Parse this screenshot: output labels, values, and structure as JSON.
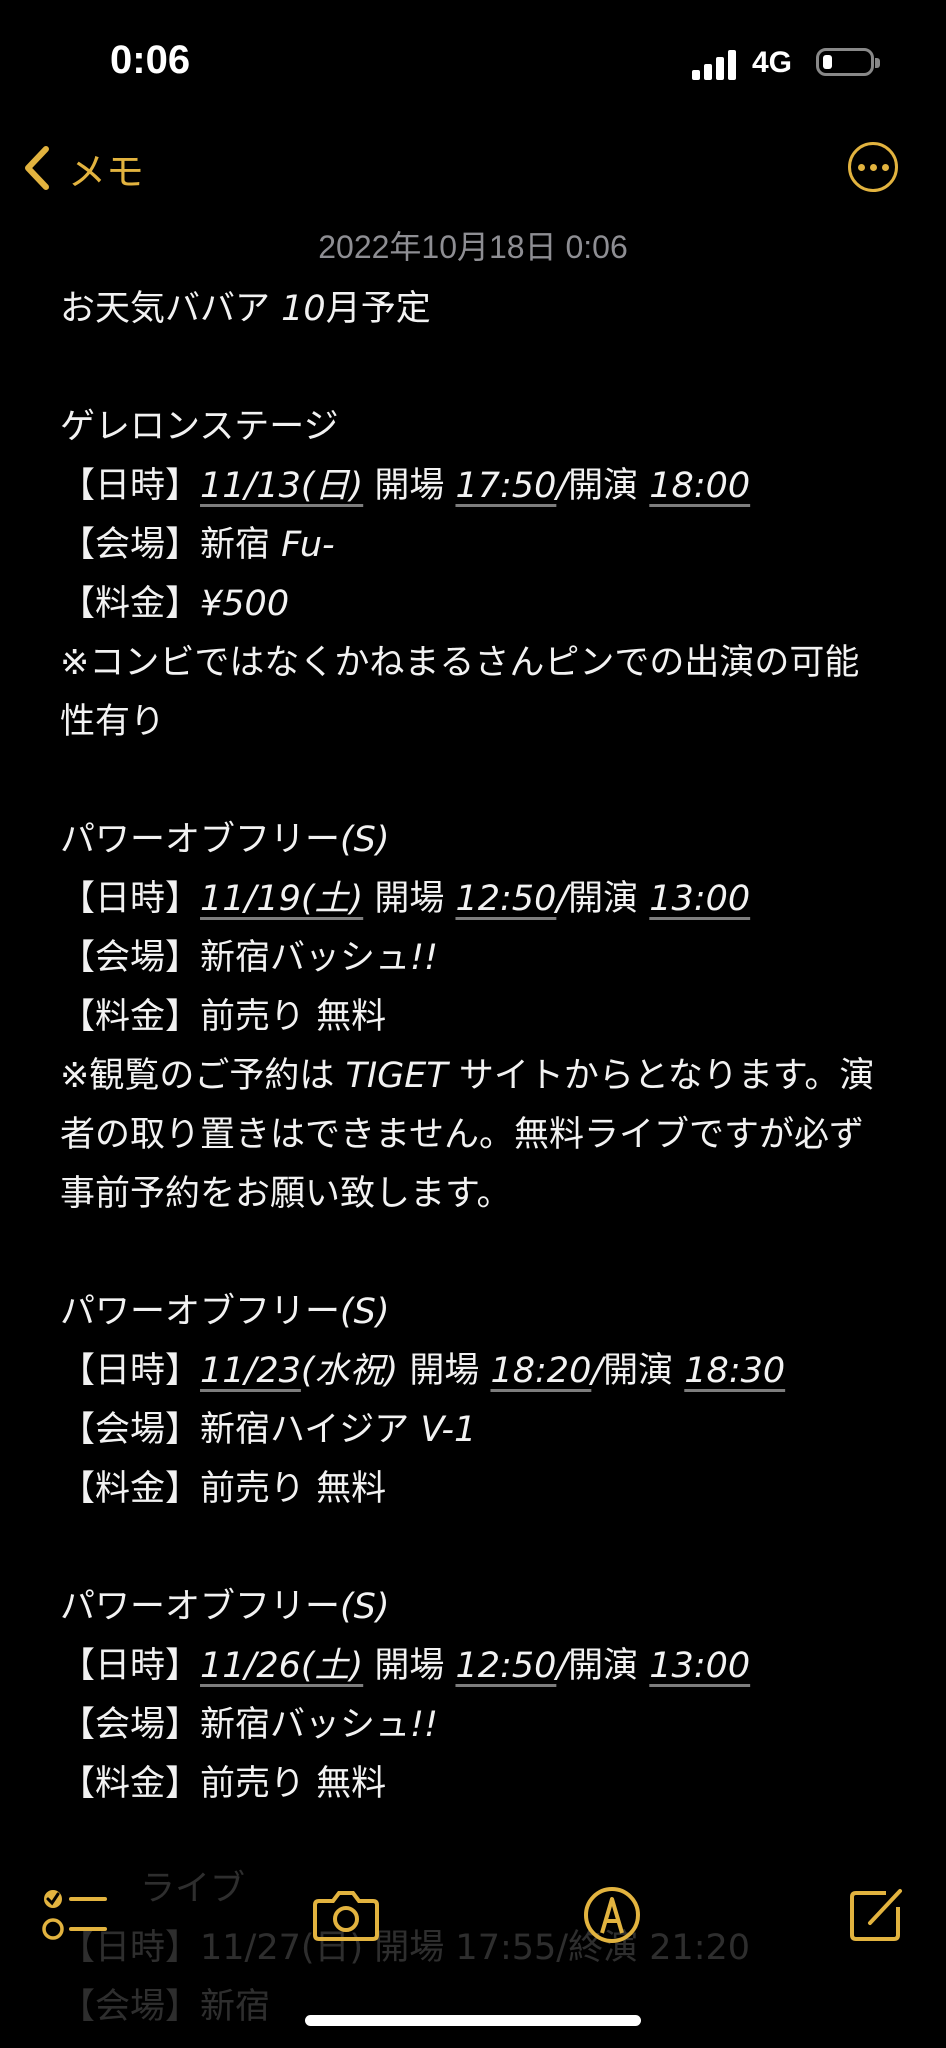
{
  "status_bar": {
    "time": "0:06",
    "network": "4G"
  },
  "nav": {
    "back_label": "メモ"
  },
  "note": {
    "date": "2022年10月18日 0:06",
    "lines": [
      [
        "お天気ババア ",
        {
          "i": "10"
        },
        "月予定"
      ],
      [],
      [
        "ゲレロンステージ"
      ],
      [
        "【日時】",
        {
          "u": "11/13(日)"
        },
        " 開場 ",
        {
          "u": "17:50"
        },
        {
          "i": "/"
        },
        "開演 ",
        {
          "u": "18:00"
        }
      ],
      [
        "【会場】新宿 ",
        {
          "i": "Fu-"
        }
      ],
      [
        "【料金】",
        {
          "i": "¥500"
        }
      ],
      {
        "wrap": [
          "※コンビではなくかねまるさんピンでの出演の可能性有り"
        ]
      },
      [],
      [
        "パワーオブフリー",
        {
          "i": "(S)"
        }
      ],
      [
        "【日時】",
        {
          "u": "11/19(土)"
        },
        " 開場 ",
        {
          "u": "12:50"
        },
        {
          "i": "/"
        },
        "開演 ",
        {
          "u": "13:00"
        }
      ],
      [
        "【会場】新宿バッシュ",
        {
          "i": "!!"
        }
      ],
      [
        "【料金】前売り 無料"
      ],
      {
        "wrap": [
          "※観覧のご予約は ",
          {
            "i": "TIGET"
          },
          " サイトからとなります。演者の取り置きはできません。無料ライブですが必ず事前予約をお願い致します。"
        ]
      },
      [],
      [
        "パワーオブフリー",
        {
          "i": "(S)"
        }
      ],
      [
        "【日時】",
        {
          "u": "11/23"
        },
        {
          "i": "(水祝)"
        },
        " 開場 ",
        {
          "u": "18:20"
        },
        {
          "i": "/"
        },
        "開演 ",
        {
          "u": "18:30"
        }
      ],
      [
        "【会場】新宿ハイジア ",
        {
          "i": "V-1"
        }
      ],
      [
        "【料金】前売り 無料"
      ],
      [],
      [
        "パワーオブフリー",
        {
          "i": "(S)"
        }
      ],
      [
        "【日時】",
        {
          "u": "11/26(土)"
        },
        " 開場 ",
        {
          "u": "12:50"
        },
        {
          "i": "/"
        },
        "開演 ",
        {
          "u": "13:00"
        }
      ],
      [
        "【会場】新宿バッシュ",
        {
          "i": "!!"
        }
      ],
      [
        "【料金】前売り 無料"
      ]
    ],
    "overflow_lines": [
      "ライブ",
      "【日時】11/27(日) 開場 17:55/終演 21:20",
      "【会場】新宿"
    ]
  },
  "colors": {
    "accent": "#e2b33f",
    "background": "#000000",
    "text": "#f2f2f2",
    "date": "#8e8e93"
  }
}
